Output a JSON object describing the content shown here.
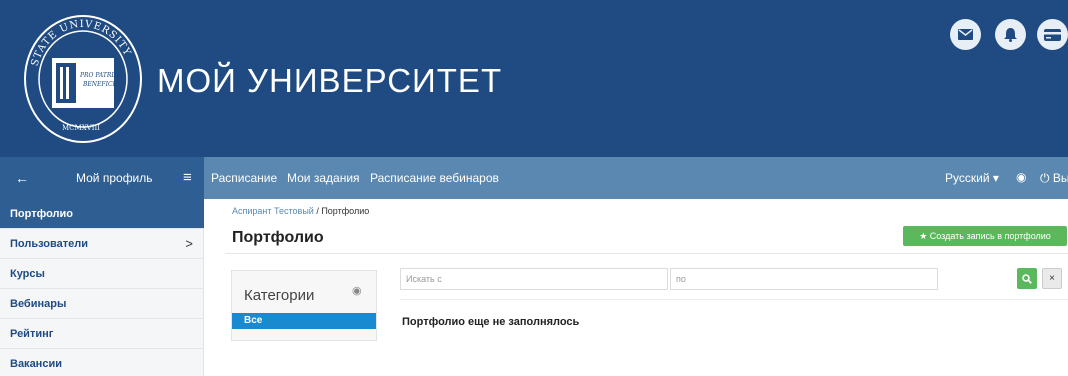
{
  "header": {
    "title": "МОЙ УНИВЕРСИТЕТ",
    "logo": {
      "ring_text": "STATE UNIVERSITY",
      "motto_line1": "PRO PATRIAE",
      "motto_line2": "BENEFICIO",
      "year": "MCMXVIII"
    },
    "icons": [
      "envelope-icon",
      "bell-icon",
      "credit-card-icon"
    ]
  },
  "navbar": {
    "profile_label": "Мой профиль",
    "links": [
      "Расписание",
      "Мои задания",
      "Расписание вебинаров"
    ],
    "language": "Русский ▾",
    "logout": "Вы"
  },
  "sidebar": {
    "items": [
      {
        "label": "Портфолио",
        "active": true
      },
      {
        "label": "Пользователи",
        "chevron": ">"
      },
      {
        "label": "Курсы"
      },
      {
        "label": "Вебинары"
      },
      {
        "label": "Рейтинг"
      },
      {
        "label": "Вакансии"
      }
    ]
  },
  "breadcrumb": {
    "parent": "Аспирант Тестовый",
    "separator": " / ",
    "current": "Портфолио"
  },
  "page": {
    "title": "Портфолио",
    "create_button": "★ Создать запись в портфолио",
    "categories_title": "Категории",
    "category_all": "Все",
    "search_from_placeholder": "Искать с",
    "search_to_placeholder": "по",
    "clear_button": "×",
    "empty_message": "Портфолио еще не заполнялось"
  },
  "colors": {
    "header_bg": "#1f4b82",
    "navbar_bg": "#5b88b0",
    "sidebar_active": "#2e5e92",
    "green_button": "#5cb85c",
    "category_selected": "#1a8ad0"
  }
}
